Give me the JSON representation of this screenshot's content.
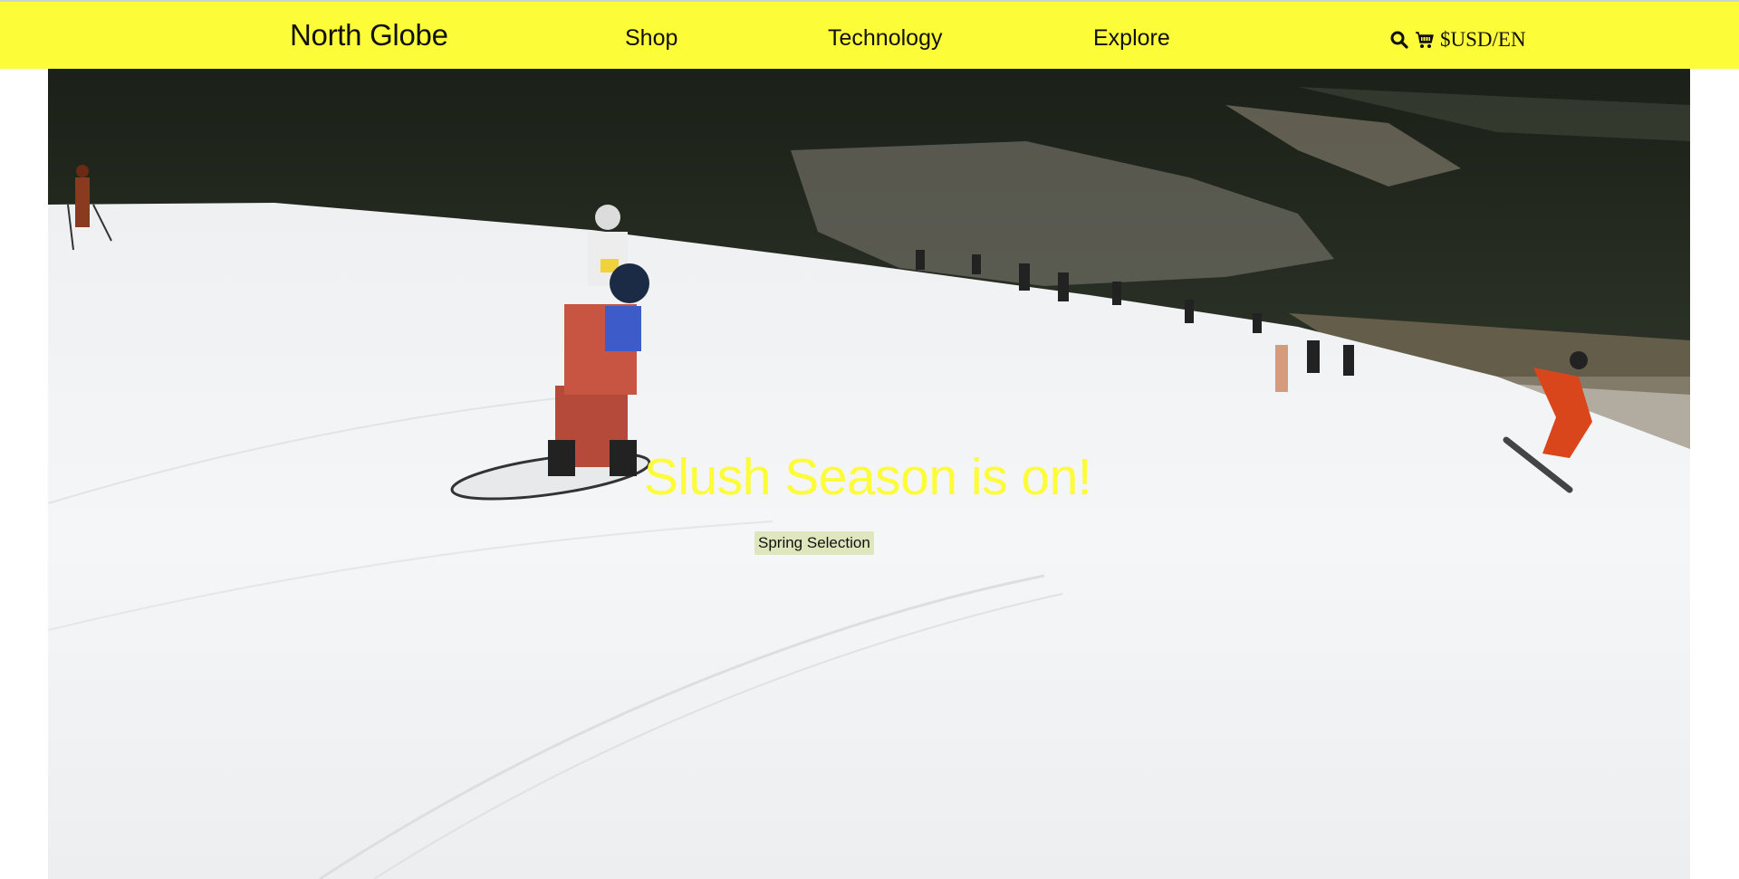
{
  "header": {
    "brand": "North Globe",
    "nav": {
      "shop": "Shop",
      "technology": "Technology",
      "explore": "Explore"
    },
    "icons": {
      "search": "search-icon",
      "cart": "cart-icon"
    },
    "locale": "$USD/EN"
  },
  "hero": {
    "image": "snowboarder on spring slushy ski slope",
    "title": "Slush Season is on!",
    "cta": "Spring Selection"
  },
  "colors": {
    "header_bg": "#fdfc39",
    "title": "#fdfc39",
    "text": "#111111"
  }
}
